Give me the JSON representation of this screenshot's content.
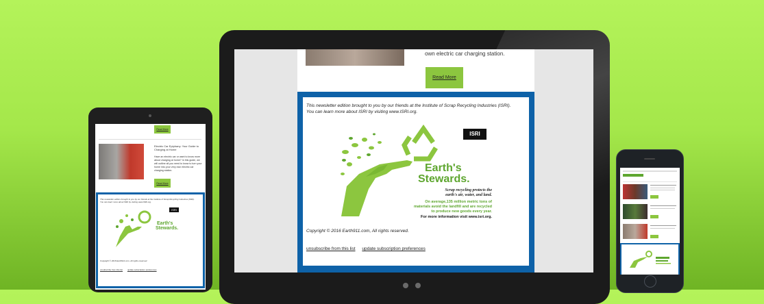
{
  "main_email": {
    "desc_text": "own electric car charging station.",
    "read_more": "Read More",
    "credit_line1": "This newsletter edition brought to you by our friends at the Institute of Scrap Recycling Industries (ISRI).",
    "credit_line2": "You can learn more about ISRI by visiting www.ISRI.org.",
    "copyright": "Copyright © 2016 Earth911.com, All rights reserved.",
    "unsubscribe": "unsubscribe from this list",
    "update_prefs": "update subscription preferences"
  },
  "banner": {
    "logo": "ISRI",
    "headline1": "Earth's",
    "headline2": "Stewards.",
    "tagline1": "Scrap recycling protects the",
    "tagline2": "earth's air, water, and land.",
    "stat1": "On average,135 million metric tons of",
    "stat2": "materials avoid the landfill and are recycled",
    "stat3": "to produce new goods every year.",
    "more_info": "For more information visit www.isri.org."
  },
  "left_email": {
    "read_more": "Read More",
    "article_title": "Electric Car Epiphany: Your Guide to Charging at Home",
    "article_body": "Have an electric car or want to know more about charging at home? In this guide, we will outline all you need to know to turn your home into your very own electric car charging station.",
    "read_more_2": "Read More"
  },
  "colors": {
    "accent_green": "#8cc63f",
    "border_blue": "#0e62a8",
    "brand_green": "#5ea62f"
  }
}
